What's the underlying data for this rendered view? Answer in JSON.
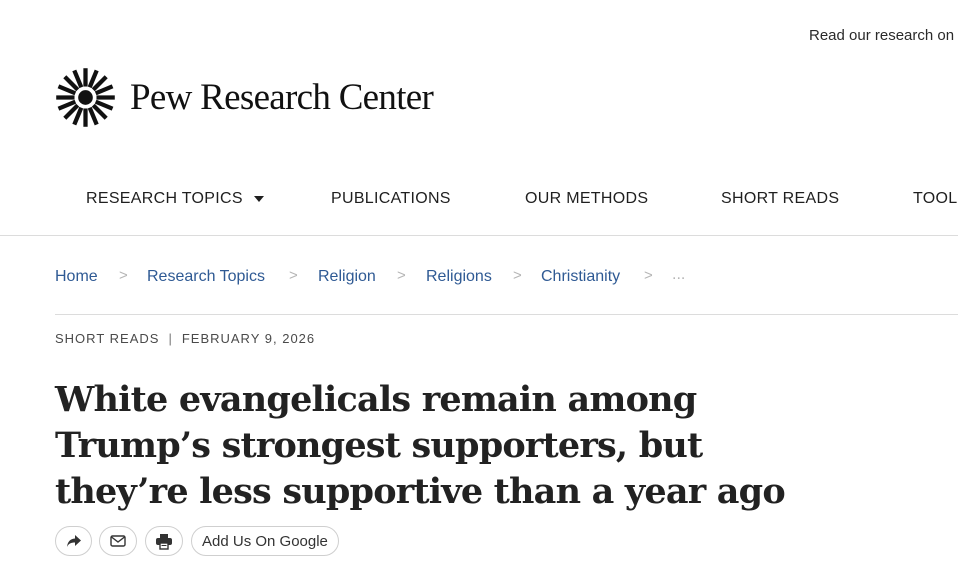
{
  "topbar": {
    "research_link": "Read our research on"
  },
  "brand": {
    "name": "Pew Research Center",
    "logo_icon": "pew-sunburst-logo"
  },
  "nav": {
    "items": [
      {
        "label": "RESEARCH TOPICS",
        "has_dropdown": true
      },
      {
        "label": "PUBLICATIONS"
      },
      {
        "label": "OUR METHODS"
      },
      {
        "label": "SHORT READS"
      },
      {
        "label": "TOOLS"
      }
    ]
  },
  "breadcrumb": {
    "items": [
      "Home",
      "Research Topics",
      "Religion",
      "Religions",
      "Christianity"
    ],
    "separator": ">",
    "more": "..."
  },
  "article": {
    "section": "SHORT READS",
    "date": "FEBRUARY 9, 2026",
    "kicker_separator": "|",
    "headline_lines": [
      "White evangelicals remain among",
      "Trump’s strongest supporters, but",
      "they’re less supportive than a year ago"
    ]
  },
  "share": {
    "icons": [
      "share-icon",
      "email-icon",
      "print-icon"
    ],
    "google_label": "Add Us On Google"
  },
  "colors": {
    "link": "#2f5a94",
    "text": "#222222",
    "divider": "#dcdcdc"
  }
}
